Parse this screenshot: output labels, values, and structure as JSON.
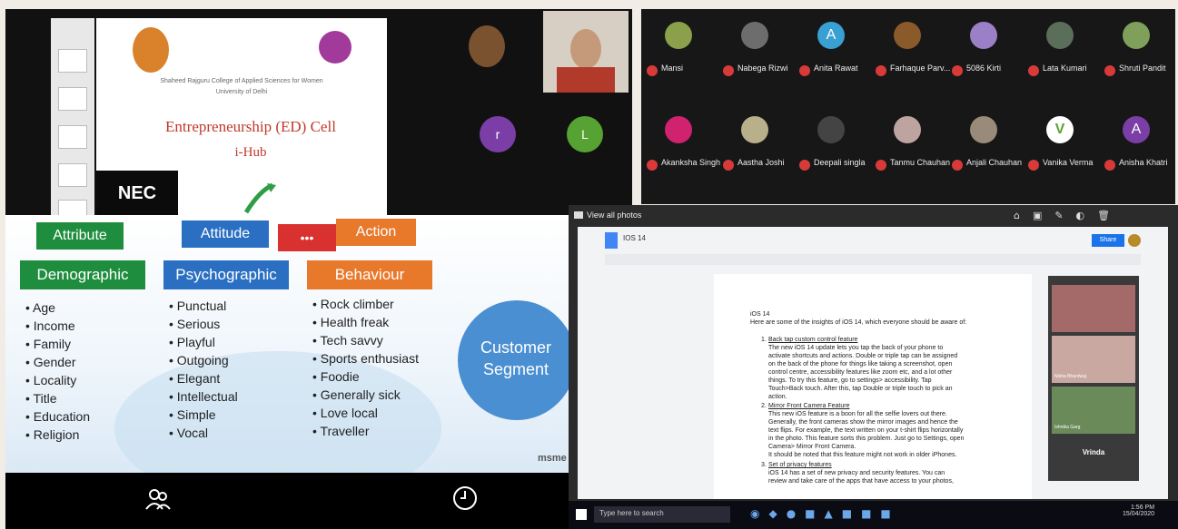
{
  "panel1": {
    "slide_college": "Shaheed Rajguru College of Applied Sciences for Women",
    "slide_university": "University of Delhi",
    "slide_title": "Entrepreneurship (ED) Cell",
    "slide_subtitle": "i-Hub",
    "slide_logo_text": "NEC",
    "tiles": [
      {
        "letter": "",
        "color": "#7a5230"
      },
      {
        "letter": "r",
        "color": "#7b3ea6"
      },
      {
        "letter": "L",
        "color": "#56a233"
      }
    ]
  },
  "panel2": {
    "participants_row1": [
      {
        "name": "Mansi",
        "letter": "",
        "color": "#8aa04a"
      },
      {
        "name": "Nabega Rizwi",
        "letter": "",
        "color": "#6d6d6d"
      },
      {
        "name": "Anita Rawat",
        "letter": "A",
        "color": "#39a0d3"
      },
      {
        "name": "Farhaque Parv...",
        "letter": "",
        "color": "#8a5a2a"
      },
      {
        "name": "5086 Kirti",
        "letter": "",
        "color": "#9b80c8"
      },
      {
        "name": "Lata Kumari",
        "letter": "",
        "color": "#5a6e5a"
      },
      {
        "name": "Shruti Pandit",
        "letter": "",
        "color": "#7fa05a"
      }
    ],
    "participants_row2": [
      {
        "name": "Akanksha Singh",
        "letter": "",
        "color": "#d0226e"
      },
      {
        "name": "Aastha Joshi",
        "letter": "",
        "color": "#b7b08a"
      },
      {
        "name": "Deepali singla",
        "letter": "",
        "color": "#444444"
      },
      {
        "name": "Tanmu Chauhan",
        "letter": "",
        "color": "#bda4a0"
      },
      {
        "name": "Anjali Chauhan",
        "letter": "",
        "color": "#9a8a7a"
      },
      {
        "name": "Vanika Verma",
        "letter": "V",
        "color": "#ffffff"
      },
      {
        "name": "Anisha Khatri",
        "letter": "A",
        "color": "#7b3ea6"
      }
    ]
  },
  "panel3": {
    "labels": {
      "attribute": "Attribute",
      "attitude": "Attitude",
      "action": "Action",
      "more": "•••"
    },
    "columns": [
      {
        "heading": "Demographic",
        "items": [
          "Age",
          "Income",
          "Family",
          "Gender",
          "Locality",
          "Title",
          "Education",
          "Religion"
        ]
      },
      {
        "heading": "Psychographic",
        "items": [
          "Punctual",
          "Serious",
          "Playful",
          "Outgoing",
          "Elegant",
          "Intellectual",
          "Simple",
          "Vocal"
        ]
      },
      {
        "heading": "Behaviour",
        "items": [
          "Rock climber",
          "Health freak",
          "Tech savvy",
          "Sports enthusiast",
          "Foodie",
          "Generally sick",
          "Love local",
          "Traveller"
        ]
      }
    ],
    "circle_text": [
      "Customer",
      "Segment"
    ],
    "brand": "msme",
    "participants_icon": "participants-icon",
    "timer_icon": "clock-icon"
  },
  "panel4": {
    "photos_bar": "View all photos",
    "doc_title": "IOS 14",
    "share_label": "Share",
    "doc_heading": "iOS 14",
    "doc_intro": "Here are some of the insights of iOS 14, which everyone should be aware of:",
    "sections": [
      {
        "num": "1.",
        "title": "Back tap custom control feature",
        "lines": [
          "The new iOS 14 update lets you tap the back of your phone to",
          "activate shortcuts and actions. Double or triple tap can be assigned",
          "on the back of the phone for things like taking a screenshot, open",
          "control centre, accessibility features like zoom etc, and a lot other",
          "things. To try this feature, go to settings> accessibility. Tap",
          "Touch>Back touch. After this, tap Double or triple touch to pick an",
          "action."
        ]
      },
      {
        "num": "2.",
        "title": "Mirror Front Camera Feature",
        "lines": [
          "This new iOS feature is a boon for all the selfie lovers out there.",
          "Generally, the front cameras show the mirror images and hence the",
          "text flips. For example, the text written on your t-shirt flips horizontally",
          "in the photo. This feature sorts this problem. Just go to Settings, open",
          "Camera> Mirror Front Camera.",
          "It should be noted that this feature might not work in older iPhones."
        ]
      },
      {
        "num": "3.",
        "title": "Set of privacy features",
        "lines": [
          "iOS 14 has a set of new privacy and security features. You can",
          "review and take care of the apps that have access to your photos,"
        ]
      }
    ],
    "video_names": [
      "",
      "Nisha Bhardwaj",
      "Ishnika Garg"
    ],
    "speaker_name": "Vrinda",
    "search_placeholder": "Type here to search",
    "clock_time": "1:56 PM",
    "clock_date": "15/04/2020"
  }
}
